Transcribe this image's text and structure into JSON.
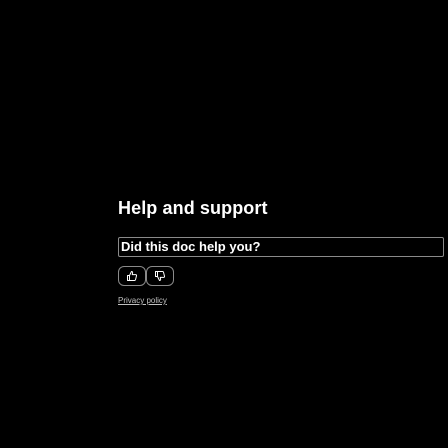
{
  "section": {
    "heading": "Help and support"
  },
  "feedback": {
    "question": "Did this doc help you?",
    "yes_icon": "thumbs-up-icon",
    "no_icon": "thumbs-down-icon"
  },
  "footer": {
    "privacy_link": "Privacy policy"
  },
  "colors": {
    "background": "#000000",
    "text": "#ffffff",
    "border": "#8a8a8a",
    "link": "#c0c0c0"
  }
}
